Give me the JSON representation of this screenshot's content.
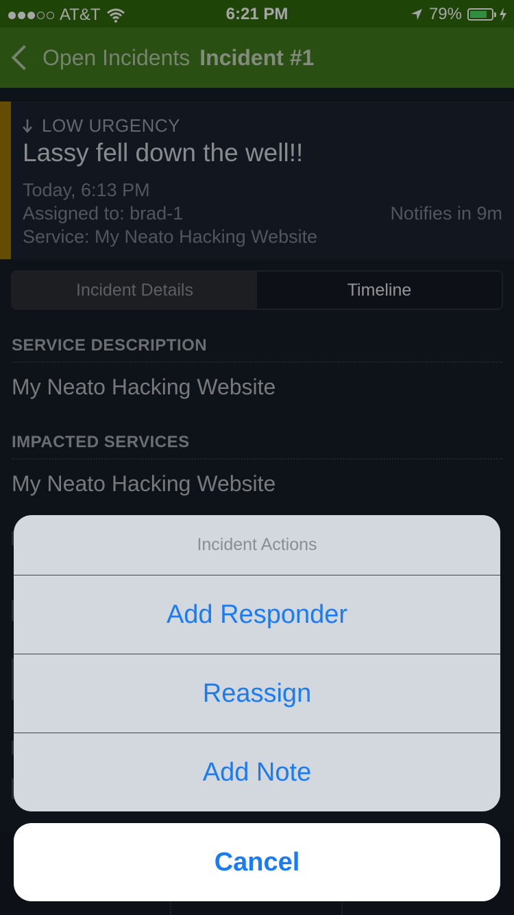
{
  "status_bar": {
    "carrier": "AT&T",
    "time": "6:21 PM",
    "battery_percent": "79%",
    "battery_level": 0.79,
    "signal_bars_filled": 3,
    "signal_bars_total": 5
  },
  "nav": {
    "back_label": "Open Incidents",
    "title": "Incident #1"
  },
  "incident": {
    "urgency": "LOW URGENCY",
    "title": "Lassy fell down the well!!",
    "time": "Today, 6:13 PM",
    "assigned": "Assigned to: brad-1",
    "service": "Service: My Neato Hacking Website",
    "notifies": "Notifies in 9m",
    "urgency_color": "#9c7505"
  },
  "tabs": [
    {
      "label": "Incident Details",
      "active": true
    },
    {
      "label": "Timeline",
      "active": false
    }
  ],
  "sections": {
    "service_description": {
      "label": "SERVICE DESCRIPTION",
      "value": "My Neato Hacking Website"
    },
    "impacted_services": {
      "label": "IMPACTED SERVICES",
      "value": "My Neato Hacking Website"
    }
  },
  "action_sheet": {
    "title": "Incident Actions",
    "actions": [
      "Add Responder",
      "Reassign",
      "Add Note"
    ],
    "cancel": "Cancel"
  },
  "colors": {
    "nav_green": "#3f7a1c",
    "action_blue": "#1a7cf5"
  }
}
